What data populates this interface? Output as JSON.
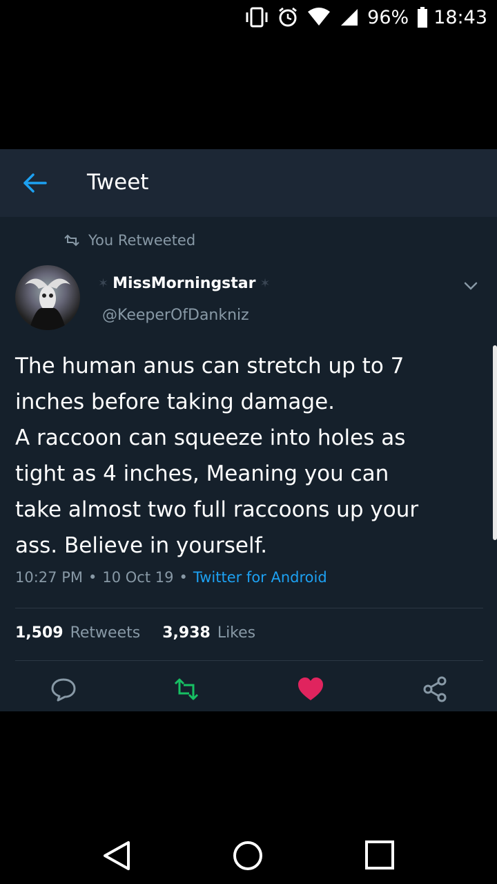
{
  "status_bar": {
    "battery_percent": "96%",
    "time": "18:43",
    "icons": [
      "vibrate-icon",
      "alarm-icon",
      "wifi-icon",
      "signal-icon",
      "battery-icon"
    ]
  },
  "header": {
    "title": "Tweet",
    "back_icon": "arrow-left-icon"
  },
  "tweet": {
    "retweet_context": "You Retweeted",
    "display_name": "MissMorningstar",
    "handle": "@KeeperOfDankniz",
    "text": "The human anus can stretch up to 7\ninches before taking damage.\nA raccoon can squeeze into holes as\ntight as 4 inches, Meaning you can\ntake almost two full raccoons up your\nass. Believe in yourself.",
    "time": "10:27 PM",
    "date": "10 Oct 19",
    "source": "Twitter for Android",
    "retweet_count": "1,509",
    "retweet_label": "Retweets",
    "like_count": "3,938",
    "like_label": "Likes"
  },
  "colors": {
    "header_bg": "#1c2735",
    "panel_bg": "#15202b",
    "accent_blue": "#1da1f2",
    "retweet_green": "#17bf63",
    "like_red": "#e0245e",
    "muted": "#8899a6"
  },
  "nav": {
    "icons": [
      "back-triangle-icon",
      "home-circle-icon",
      "recents-square-icon"
    ]
  }
}
